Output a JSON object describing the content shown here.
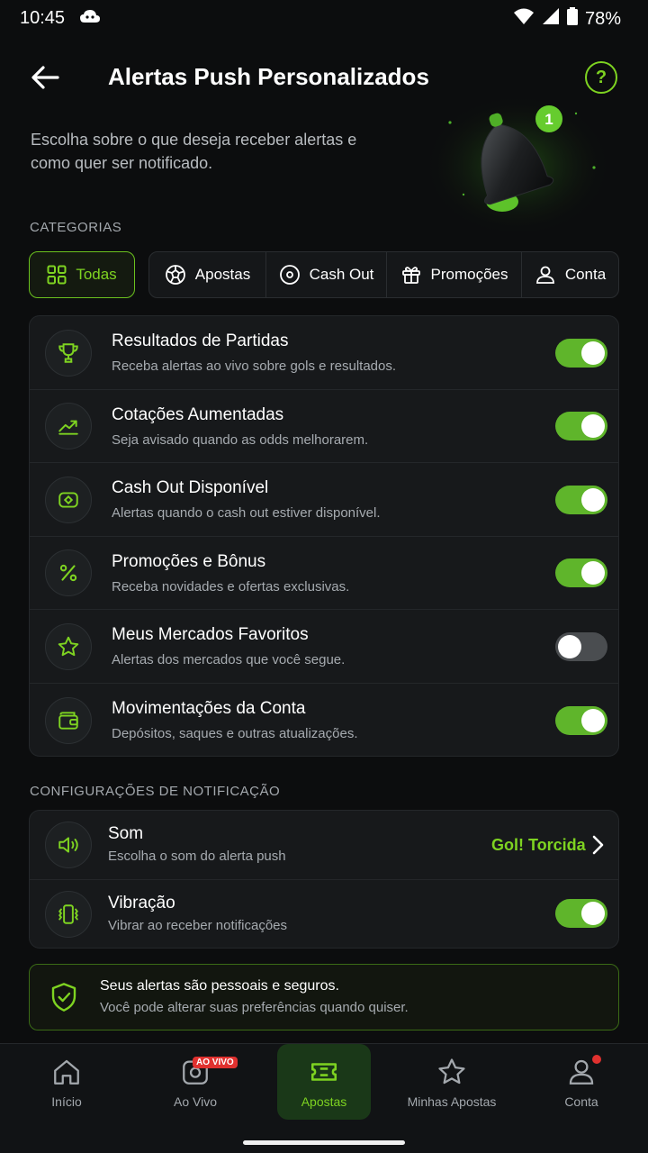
{
  "status": {
    "time": "10:45",
    "battery": "78%"
  },
  "header": {
    "title": "Alertas Push Personalizados",
    "help": "?"
  },
  "intro": "Escolha sobre o que deseja receber alertas e como quer ser notificado.",
  "bell_badge": "1",
  "categories": {
    "label": "CATEGORIAS",
    "tabs": [
      {
        "label": "Todas",
        "icon": "grid-icon",
        "active": true
      },
      {
        "label": "Apostas",
        "icon": "ball-icon"
      },
      {
        "label": "Cash Out",
        "icon": "coin-icon"
      },
      {
        "label": "Promoções",
        "icon": "gift-icon"
      },
      {
        "label": "Conta",
        "icon": "user-icon"
      }
    ]
  },
  "alerts": [
    {
      "title": "Resultados de Partidas",
      "desc": "Receba alertas ao vivo sobre gols e resultados.",
      "icon": "trophy-icon",
      "enabled": true
    },
    {
      "title": "Cotações Aumentadas",
      "desc": "Seja avisado quando as odds melhorarem.",
      "icon": "trend-up-icon",
      "enabled": true
    },
    {
      "title": "Cash Out Disponível",
      "desc": "Alertas quando o cash out estiver disponível.",
      "icon": "cashout-icon",
      "enabled": true
    },
    {
      "title": "Promoções e Bônus",
      "desc": "Receba novidades e ofertas exclusivas.",
      "icon": "percent-icon",
      "enabled": true
    },
    {
      "title": "Meus Mercados Favoritos",
      "desc": "Alertas dos mercados que você segue.",
      "icon": "star-icon",
      "enabled": false
    },
    {
      "title": "Movimentações da Conta",
      "desc": "Depósitos, saques e outras atualizações.",
      "icon": "wallet-icon",
      "enabled": true
    }
  ],
  "notification_settings": {
    "label": "CONFIGURAÇÕES DE NOTIFICAÇÃO",
    "sound": {
      "title": "Som",
      "desc": "Escolha o som do alerta push",
      "value": "Gol! Torcida"
    },
    "vibration": {
      "title": "Vibração",
      "desc": "Vibrar ao receber notificações",
      "enabled": true
    }
  },
  "privacy": {
    "title": "Seus alertas são pessoais e seguros.",
    "desc": "Você pode alterar suas preferências quando quiser."
  },
  "nav": {
    "items": [
      {
        "label": "Início",
        "icon": "home-icon"
      },
      {
        "label": "Ao Vivo",
        "icon": "live-icon",
        "badge": "AO VIVO"
      },
      {
        "label": "Apostas",
        "icon": "ticket-icon",
        "active": true
      },
      {
        "label": "Minhas Apostas",
        "icon": "star-outline-icon"
      },
      {
        "label": "Conta",
        "icon": "account-icon"
      }
    ]
  },
  "colors": {
    "accent": "#7ed321",
    "background": "#0c0d0e",
    "card": "#17191b",
    "live_badge": "#e0312f"
  }
}
